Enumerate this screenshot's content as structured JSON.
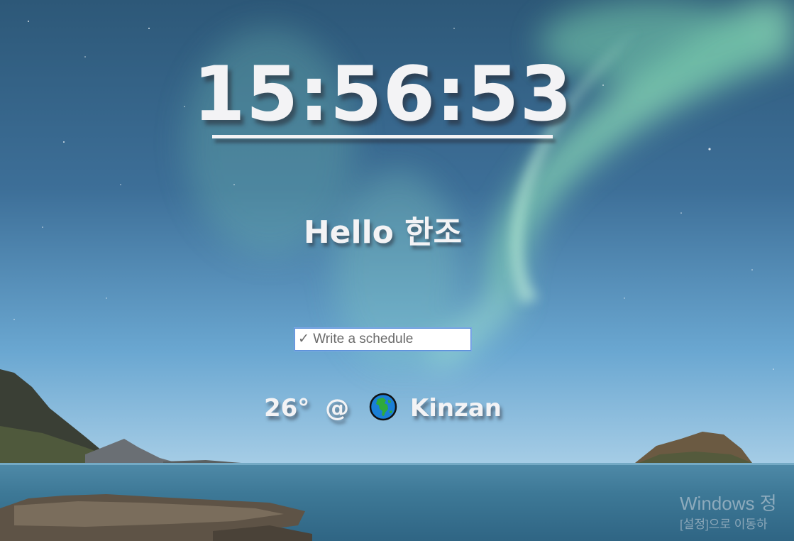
{
  "clock": {
    "time": "15:56:53"
  },
  "greeting": {
    "text": "Hello 한조"
  },
  "schedule": {
    "placeholder": "✓ Write a schedule",
    "value": ""
  },
  "weather": {
    "temperature": "26°",
    "separator": "@",
    "icon": "globe-icon",
    "location": "Kinzan"
  },
  "watermark": {
    "line1": "Windows 정",
    "line2": "[설정]으로 이동하"
  },
  "colors": {
    "text": "#f3f3f5",
    "input_border": "#5a8fd8",
    "sky_top": "#2d5878",
    "aurora": "#7fd8b0",
    "sea": "#3d7896"
  }
}
